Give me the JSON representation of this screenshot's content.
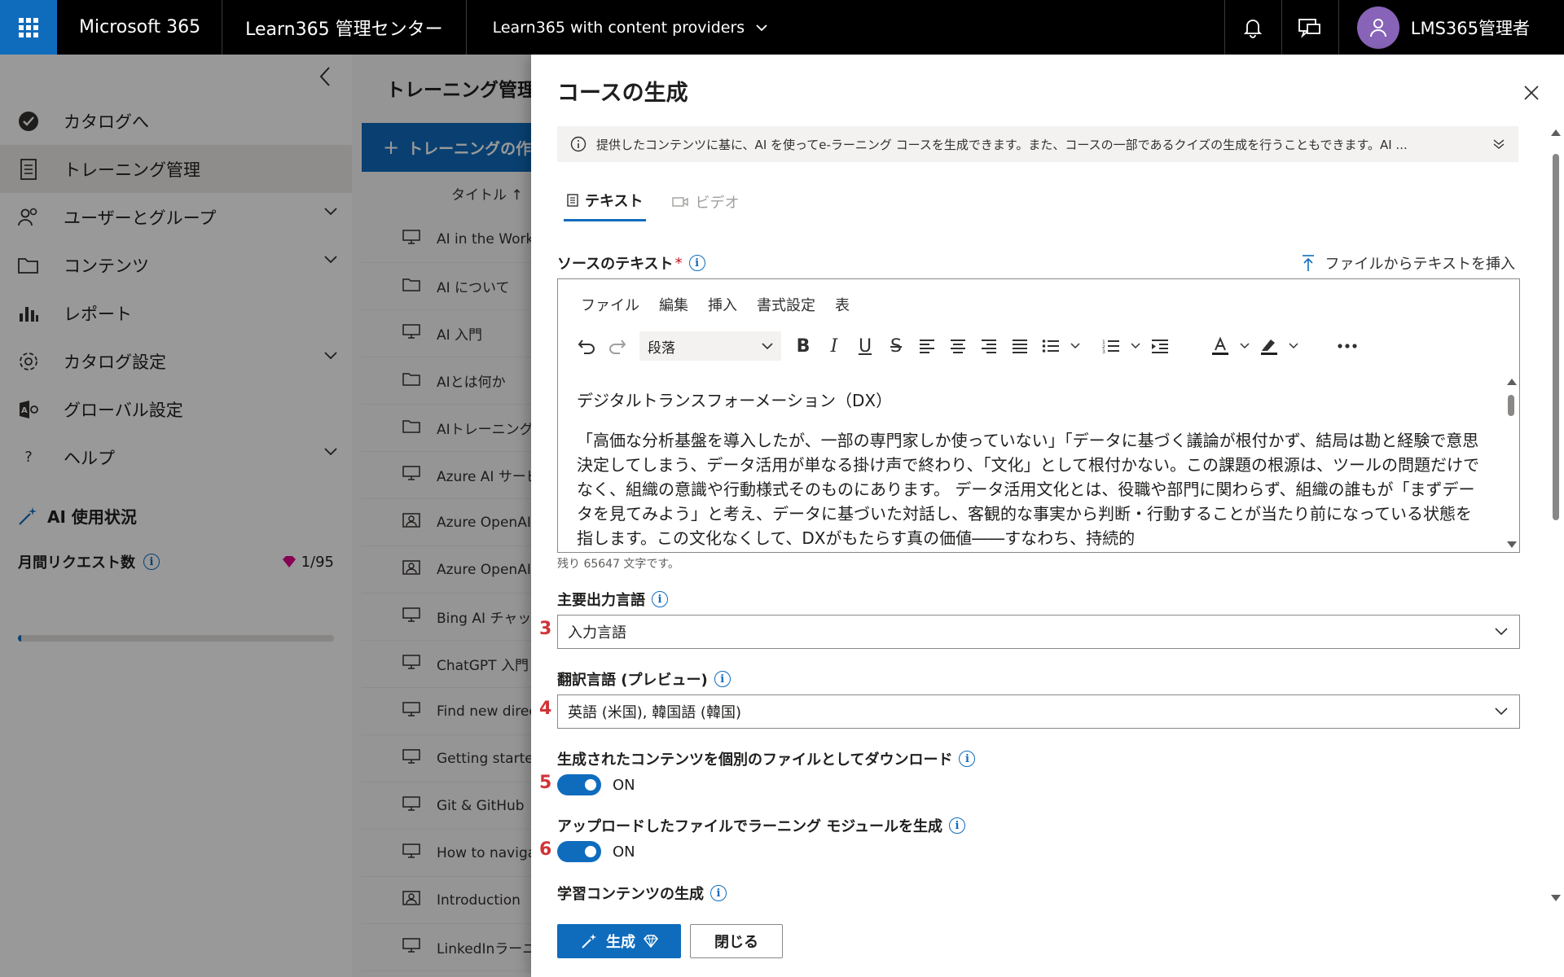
{
  "topbar": {
    "brand": "Microsoft 365",
    "admin_title": "Learn365 管理センター",
    "tenant": "Learn365 with content providers",
    "user_name": "LMS365管理者",
    "icons": [
      "waffle-icon",
      "bell-icon",
      "feedback-icon",
      "person-icon"
    ]
  },
  "leftnav": {
    "items": [
      {
        "label": "カタログへ",
        "icon": "catalog-icon",
        "expandable": false,
        "active": false
      },
      {
        "label": "トレーニング管理",
        "icon": "training-icon",
        "expandable": false,
        "active": true
      },
      {
        "label": "ユーザーとグループ",
        "icon": "users-icon",
        "expandable": true,
        "active": false
      },
      {
        "label": "コンテンツ",
        "icon": "folder-icon",
        "expandable": true,
        "active": false
      },
      {
        "label": "レポート",
        "icon": "chart-icon",
        "expandable": false,
        "active": false
      },
      {
        "label": "カタログ設定",
        "icon": "gear-icon",
        "expandable": true,
        "active": false
      },
      {
        "label": "グローバル設定",
        "icon": "global-settings-icon",
        "expandable": false,
        "active": false
      },
      {
        "label": "ヘルプ",
        "icon": "help-icon",
        "expandable": true,
        "active": false
      }
    ],
    "ai_usage_label": "AI 使用状況",
    "monthly_requests_label": "月間リクエスト数",
    "monthly_requests_value": "1/95",
    "monthly_requests_fraction": 0.0105
  },
  "middle": {
    "title": "トレーニング管理",
    "create_button": "トレーニングの作成",
    "column_title": "タイトル ↑",
    "rows": [
      {
        "title": "AI in the Workplace",
        "icon": "course-icon"
      },
      {
        "title": "AI について",
        "icon": "folder-icon"
      },
      {
        "title": "AI 入門",
        "icon": "course-icon"
      },
      {
        "title": "AIとは何か",
        "icon": "folder-icon"
      },
      {
        "title": "AIトレーニング",
        "icon": "folder-icon"
      },
      {
        "title": "Azure AI サービス",
        "icon": "course-icon"
      },
      {
        "title": "Azure OpenAI",
        "icon": "learning-path-icon"
      },
      {
        "title": "Azure OpenAI Service",
        "icon": "learning-path-icon"
      },
      {
        "title": "Bing AI チャット",
        "icon": "course-icon"
      },
      {
        "title": "ChatGPT 入門",
        "icon": "course-icon"
      },
      {
        "title": "Find new directions",
        "icon": "course-icon"
      },
      {
        "title": "Getting started",
        "icon": "course-icon"
      },
      {
        "title": "Git & GitHub",
        "icon": "course-icon"
      },
      {
        "title": "How to navigate",
        "icon": "course-icon"
      },
      {
        "title": "Introduction",
        "icon": "learning-path-icon"
      },
      {
        "title": "LinkedInラーニング",
        "icon": "course-icon"
      }
    ]
  },
  "panel": {
    "title": "コースの生成",
    "notice": "提供したコンテンツに基に、AI を使ってe-ラーニング コースを生成できます。また、コースの一部であるクイズの生成を行うこともできます。AI ...",
    "tabs": [
      {
        "label": "テキスト",
        "active": true
      },
      {
        "label": "ビデオ",
        "active": false
      }
    ],
    "source_label": "ソースのテキスト",
    "required_mark": "*",
    "insert_from_file": "ファイルからテキストを挿入",
    "editor": {
      "menu": [
        "ファイル",
        "編集",
        "挿入",
        "書式設定",
        "表"
      ],
      "paragraph_select": "段落",
      "heading": "デジタルトランスフォーメーション（DX）",
      "body": "「高価な分析基盤を導入したが、一部の専門家しか使っていない」「データに基づく議論が根付かず、結局は勘と経験で意思決定してしまう、データ活用が単なる掛け声で終わり、「文化」として根付かない。この課題の根源は、ツールの問題だけでなく、組織の意識や行動様式そのものにあります。 データ活用文化とは、役職や部門に関わらず、組織の誰もが「まずデータを見てみよう」と考え、データに基づいた対話し、客観的な事実から判断・行動することが当たり前になっている状態を指します。この文化なくして、DXがもたらす真の価値――すなわち、持続的",
      "chars_remaining": "残り 65647 文字です。"
    },
    "primary_language": {
      "label": "主要出力言語",
      "value": "入力言語",
      "step": "3"
    },
    "translation_language": {
      "label": "翻訳言語 (プレビュー)",
      "value": "英語 (米国), 韓国語 (韓国)",
      "step": "4"
    },
    "download_separate": {
      "label": "生成されたコンテンツを個別のファイルとしてダウンロード",
      "state": "ON",
      "step": "5"
    },
    "generate_module": {
      "label": "アップロードしたファイルでラーニング モジュールを生成",
      "state": "ON",
      "step": "6"
    },
    "learning_content_label": "学習コンテンツの生成",
    "generate_button": "生成",
    "close_button": "閉じる"
  },
  "colors": {
    "accent": "#0f6cbd",
    "topbar": "#000000",
    "step_number": "#d13438",
    "required": "#c50f1f",
    "premium_gem": "#e3008c"
  }
}
